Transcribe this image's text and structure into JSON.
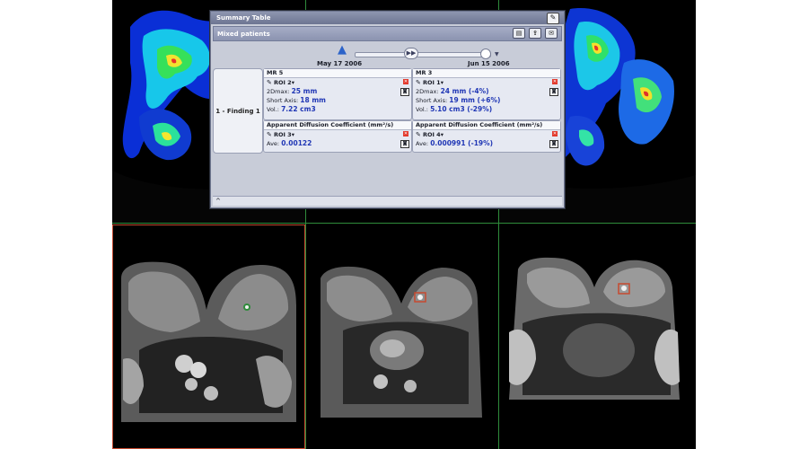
{
  "summary_table": {
    "title": "Summary Table",
    "title_icon": "pen-icon",
    "patient_label": "Mixed patients",
    "toolbar_icons": [
      "print-icon",
      "export-icon",
      "chat-icon"
    ],
    "timeline": {
      "start_icon": "timeline-start-icon",
      "ff_label": "▶▶"
    },
    "finding_label": "1 - Finding 1",
    "studies": [
      {
        "date": "May 17 2006",
        "mr_label": "MR 5",
        "roi_a": "ROI 2",
        "dmax_label": "2Dmax:",
        "dmax_value": "25 mm",
        "short_axis_label": "Short Axis:",
        "short_axis_value": "18 mm",
        "vol_label": "Vol.:",
        "vol_value": "7.22 cm3",
        "adc_header": "Apparent Diffusion Coefficient (mm²/s)",
        "roi_b": "ROI 3",
        "ave_label": "Ave:",
        "ave_value": "0.00122"
      },
      {
        "date": "Jun 15 2006",
        "mr_label": "MR 3",
        "roi_a": "ROI 1",
        "dmax_label": "2Dmax:",
        "dmax_value": "24 mm (-4%)",
        "short_axis_label": "Short Axis:",
        "short_axis_value": "19 mm (+6%)",
        "vol_label": "Vol.:",
        "vol_value": "5.10 cm3 (-29%)",
        "adc_header": "Apparent Diffusion Coefficient (mm²/s)",
        "roi_b": "ROI 4",
        "ave_label": "Ave:",
        "ave_value": "0.000991 (-19%)"
      }
    ],
    "footer_arrow": "^"
  },
  "colors": {
    "grid_line": "#2f8c3b",
    "selected_pane": "#c64a30",
    "value_text": "#2037b5"
  }
}
